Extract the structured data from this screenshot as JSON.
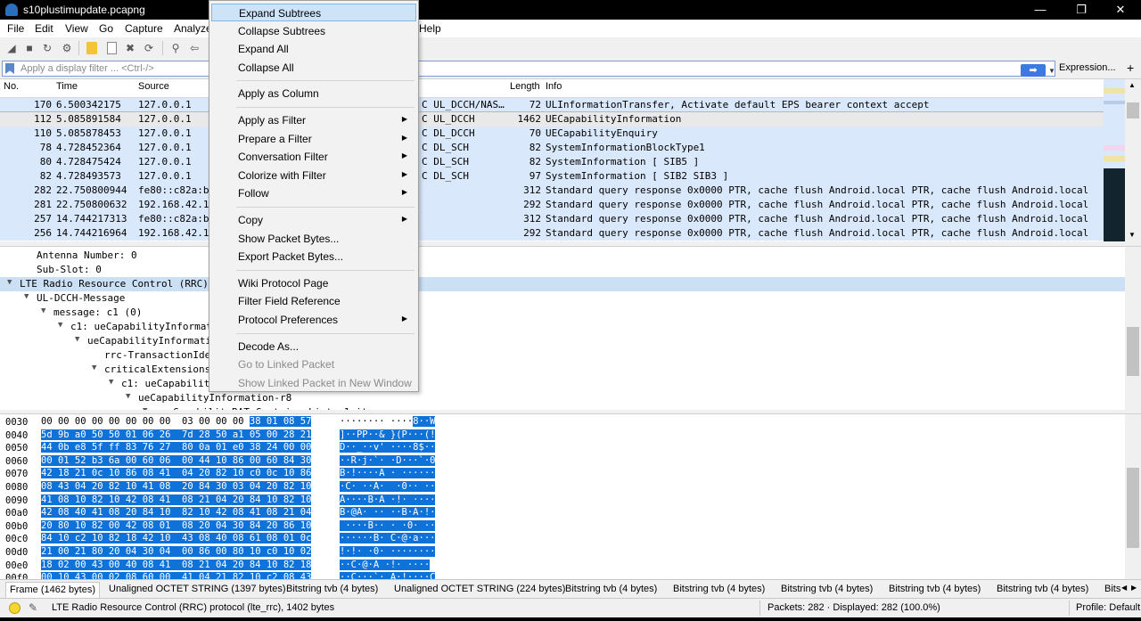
{
  "window": {
    "title": "s10plustimupdate.pcapng",
    "minimize": "—",
    "restore": "❐",
    "close": "✕"
  },
  "menubar": [
    "File",
    "Edit",
    "View",
    "Go",
    "Capture",
    "Analyze",
    "Help"
  ],
  "toolbar_icons": [
    "shark-fin-icon",
    "stop-icon",
    "restart-icon",
    "options-icon",
    "open-icon",
    "close-file-icon",
    "save-icon",
    "find-icon",
    "back-icon"
  ],
  "filter": {
    "placeholder": "Apply a display filter ... <Ctrl-/>",
    "apply_label": "➡",
    "dropdown": "▼",
    "expression": "Expression...",
    "plus": "+"
  },
  "packet_list": {
    "columns": [
      "No.",
      "Time",
      "Source",
      "Length",
      "Info"
    ],
    "rows": [
      {
        "no": "170",
        "time": "6.500342175",
        "source": "127.0.0.1",
        "protocol": "C UL_DCCH/NAS…",
        "length": "72",
        "info": "ULInformationTransfer, Activate default EPS bearer context accept",
        "selected": false
      },
      {
        "no": "112",
        "time": "5.085891584",
        "source": "127.0.0.1",
        "protocol": "C UL_DCCH",
        "length": "1462",
        "info": "UECapabilityInformation",
        "selected": true
      },
      {
        "no": "110",
        "time": "5.085878453",
        "source": "127.0.0.1",
        "protocol": "C DL_DCCH",
        "length": "70",
        "info": "UECapabilityEnquiry",
        "selected": false
      },
      {
        "no": "78",
        "time": "4.728452364",
        "source": "127.0.0.1",
        "protocol": "C DL_SCH",
        "length": "82",
        "info": "SystemInformationBlockType1",
        "selected": false
      },
      {
        "no": "80",
        "time": "4.728475424",
        "source": "127.0.0.1",
        "protocol": "C DL_SCH",
        "length": "82",
        "info": "SystemInformation [ SIB5 ]",
        "selected": false
      },
      {
        "no": "82",
        "time": "4.728493573",
        "source": "127.0.0.1",
        "protocol": "C DL_SCH",
        "length": "97",
        "info": "SystemInformation [ SIB2 SIB3 ]",
        "selected": false
      },
      {
        "no": "282",
        "time": "22.750800944",
        "source": "fe80::c82a:b",
        "protocol": "",
        "length": "312",
        "info": "Standard query response 0x0000 PTR, cache flush Android.local PTR, cache flush Android.local ...",
        "selected": false
      },
      {
        "no": "281",
        "time": "22.750800632",
        "source": "192.168.42.1",
        "protocol": "",
        "length": "292",
        "info": "Standard query response 0x0000 PTR, cache flush Android.local PTR, cache flush Android.local ...",
        "selected": false
      },
      {
        "no": "257",
        "time": "14.744217313",
        "source": "fe80::c82a:b",
        "protocol": "",
        "length": "312",
        "info": "Standard query response 0x0000 PTR, cache flush Android.local PTR, cache flush Android.local ...",
        "selected": false
      },
      {
        "no": "256",
        "time": "14.744216964",
        "source": "192.168.42.1",
        "protocol": "",
        "length": "292",
        "info": "Standard query response 0x0000 PTR, cache flush Android.local PTR, cache flush Android.local ...",
        "selected": false
      }
    ]
  },
  "details": [
    {
      "indent": 0,
      "arrow": "",
      "text": "Antenna Number: 0",
      "highlight": false
    },
    {
      "indent": 0,
      "arrow": "",
      "text": "Sub-Slot: 0",
      "highlight": false
    },
    {
      "indent": 0,
      "arrow": "▼",
      "text": "LTE Radio Resource Control (RRC)",
      "highlight": true
    },
    {
      "indent": 1,
      "arrow": "▼",
      "text": "UL-DCCH-Message",
      "highlight": false
    },
    {
      "indent": 2,
      "arrow": "▼",
      "text": "message: c1 (0)",
      "highlight": false
    },
    {
      "indent": 3,
      "arrow": "▼",
      "text": "c1: ueCapabilityInformat",
      "highlight": false
    },
    {
      "indent": 4,
      "arrow": "▼",
      "text": "ueCapabilityInformati",
      "highlight": false
    },
    {
      "indent": 5,
      "arrow": "",
      "text": "rrc-TransactionIde",
      "highlight": false
    },
    {
      "indent": 5,
      "arrow": "▼",
      "text": "criticalExtensions",
      "highlight": false
    },
    {
      "indent": 6,
      "arrow": "▼",
      "text": "c1: ueCapabilit",
      "highlight": false
    },
    {
      "indent": 7,
      "arrow": "▼",
      "text": "ueCapabilityInformation-r8",
      "highlight": false
    },
    {
      "indent": 8,
      "arrow": "▼",
      "text": "ue-CapabilityRAT-ContainerList: 1 item",
      "highlight": false
    }
  ],
  "bytes": [
    {
      "offset": "0030",
      "hex_plain": "00 00 00 00 00 00 00 00  03 00 00 00 ",
      "hex_sel": "38 01 08 57",
      "ascii_plain": "········ ····",
      "ascii_sel": "8··W"
    },
    {
      "offset": "0040",
      "hex_plain": "",
      "hex_sel": "5d 9b a0 50 50 01 06 26  7d 28 50 a1 05 00 28 21",
      "ascii_plain": "",
      "ascii_sel": "]··PP··& }(P···(!"
    },
    {
      "offset": "0050",
      "hex_plain": "",
      "hex_sel": "44 0b e8 5f ff 83 76 27  80 0a 01 e0 38 24 00 00",
      "ascii_plain": "",
      "ascii_sel": "D··_··v' ····8$··"
    },
    {
      "offset": "0060",
      "hex_plain": "",
      "hex_sel": "00 01 52 b3 6a 00 60 06  00 44 10 86 00 60 84 30",
      "ascii_plain": "",
      "ascii_sel": "··R·j·`· ·D···`·0"
    },
    {
      "offset": "0070",
      "hex_plain": "",
      "hex_sel": "42 18 21 0c 10 86 08 41  04 20 82 10 c0 0c 10 86",
      "ascii_plain": "",
      "ascii_sel": "B·!····A · ······"
    },
    {
      "offset": "0080",
      "hex_plain": "",
      "hex_sel": "08 43 04 20 82 10 41 08  20 84 30 03 04 20 82 10",
      "ascii_plain": "",
      "ascii_sel": "·C· ··A·  ·0·· ··"
    },
    {
      "offset": "0090",
      "hex_plain": "",
      "hex_sel": "41 08 10 82 10 42 08 41  08 21 04 20 84 10 82 10",
      "ascii_plain": "",
      "ascii_sel": "A····B·A ·!· ····"
    },
    {
      "offset": "00a0",
      "hex_plain": "",
      "hex_sel": "42 08 40 41 08 20 84 10  82 10 42 08 41 08 21 04",
      "ascii_plain": "",
      "ascii_sel": "B·@A· ·· ··B·A·!·"
    },
    {
      "offset": "00b0",
      "hex_plain": "",
      "hex_sel": "20 80 10 82 00 42 08 01  08 20 04 30 84 20 86 10",
      "ascii_plain": "",
      "ascii_sel": " ····B·· · ·0· ··"
    },
    {
      "offset": "00c0",
      "hex_plain": "",
      "hex_sel": "84 10 c2 10 82 18 42 10  43 08 40 08 61 08 01 0c",
      "ascii_plain": "",
      "ascii_sel": "······B· C·@·a···"
    },
    {
      "offset": "00d0",
      "hex_plain": "",
      "hex_sel": "21 00 21 80 20 04 30 04  00 86 00 80 10 c0 10 02",
      "ascii_plain": "",
      "ascii_sel": "!·!· ·0· ········"
    },
    {
      "offset": "00e0",
      "hex_plain": "",
      "hex_sel": "18 02 00 43 00 40 08 41  08 21 04 20 84 10 82 18",
      "ascii_plain": "",
      "ascii_sel": "··C·@·A ·!· ····"
    },
    {
      "offset": "00f0",
      "hex_plain": "",
      "hex_sel": "00 10 43 00 02 08 60 00  41 04 21 82 10 c2 08 43",
      "ascii_plain": "",
      "ascii_sel": "··C···`· A·!····C"
    }
  ],
  "byte_tabs": [
    "Frame (1462 bytes)",
    "Unaligned OCTET STRING (1397 bytes)",
    "Bitstring tvb (4 bytes)",
    "Unaligned OCTET STRING (224 bytes)",
    "Bitstring tvb (4 bytes)",
    "Bitstring tvb (4 bytes)",
    "Bitstring tvb (4 bytes)",
    "Bitstring tvb (4 bytes)",
    "Bitstring tvb (4 bytes)",
    "Bits"
  ],
  "status": {
    "text": "LTE Radio Resource Control (RRC) protocol (lte_rrc), 1402 bytes",
    "packets": "Packets: 282 · Displayed: 282 (100.0%)",
    "profile": "Profile: Default"
  },
  "context_menu": [
    {
      "label": "Expand Subtrees",
      "submenu": false,
      "disabled": false,
      "hover": true
    },
    {
      "label": "Collapse Subtrees",
      "submenu": false,
      "disabled": false,
      "hover": false
    },
    {
      "label": "Expand All",
      "submenu": false,
      "disabled": false,
      "hover": false
    },
    {
      "label": "Collapse All",
      "submenu": false,
      "disabled": false,
      "hover": false
    },
    {
      "separator": true
    },
    {
      "label": "Apply as Column",
      "submenu": false,
      "disabled": false,
      "hover": false
    },
    {
      "separator": true
    },
    {
      "label": "Apply as Filter",
      "submenu": true,
      "disabled": false,
      "hover": false
    },
    {
      "label": "Prepare a Filter",
      "submenu": true,
      "disabled": false,
      "hover": false
    },
    {
      "label": "Conversation Filter",
      "submenu": true,
      "disabled": false,
      "hover": false
    },
    {
      "label": "Colorize with Filter",
      "submenu": true,
      "disabled": false,
      "hover": false
    },
    {
      "label": "Follow",
      "submenu": true,
      "disabled": false,
      "hover": false
    },
    {
      "separator": true
    },
    {
      "label": "Copy",
      "submenu": true,
      "disabled": false,
      "hover": false
    },
    {
      "label": "Show Packet Bytes...",
      "submenu": false,
      "disabled": false,
      "hover": false
    },
    {
      "label": "Export Packet Bytes...",
      "submenu": false,
      "disabled": false,
      "hover": false
    },
    {
      "separator": true
    },
    {
      "label": "Wiki Protocol Page",
      "submenu": false,
      "disabled": false,
      "hover": false
    },
    {
      "label": "Filter Field Reference",
      "submenu": false,
      "disabled": false,
      "hover": false
    },
    {
      "label": "Protocol Preferences",
      "submenu": true,
      "disabled": false,
      "hover": false
    },
    {
      "separator": true
    },
    {
      "label": "Decode As...",
      "submenu": false,
      "disabled": false,
      "hover": false
    },
    {
      "label": "Go to Linked Packet",
      "submenu": false,
      "disabled": true,
      "hover": false
    },
    {
      "label": "Show Linked Packet in New Window",
      "submenu": false,
      "disabled": true,
      "hover": false
    }
  ],
  "colors": {
    "row_bg": "#dae8fb",
    "selection_blue": "#0e72d8",
    "menu_hover": "#cde3f8"
  }
}
